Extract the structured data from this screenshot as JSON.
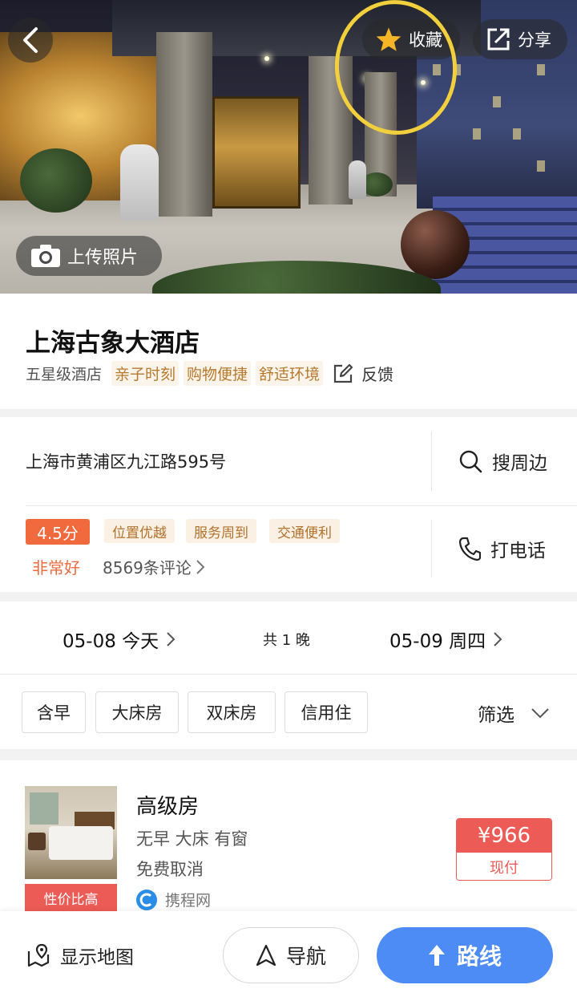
{
  "hero": {
    "favorite_label": "收藏",
    "share_label": "分享",
    "upload_label": "上传照片"
  },
  "hotel": {
    "name": "上海古象大酒店",
    "grade": "五星级酒店",
    "tags": [
      "亲子时刻",
      "购物便捷",
      "舒适环境"
    ],
    "feedback_label": "反馈",
    "address": "上海市黄浦区九江路595号",
    "search_nearby_label": "搜周边",
    "call_label": "打电话",
    "score": "4.5分",
    "score_word": "非常好",
    "score_tags": [
      "位置优越",
      "服务周到",
      "交通便利"
    ],
    "reviews": "8569条评论"
  },
  "dates": {
    "checkin": "05-08 今天",
    "nights": "共 1 晚",
    "checkout": "05-09 周四"
  },
  "filters": {
    "chips": [
      "含早",
      "大床房",
      "双床房",
      "信用住"
    ],
    "screen_label": "筛选"
  },
  "room": {
    "name": "高级房",
    "features": "无早 大床 有窗",
    "cancel": "免费取消",
    "badge": "性价比高",
    "provider": "携程网",
    "price": "¥966",
    "pay_type": "现付"
  },
  "bottom": {
    "map_label": "显示地图",
    "nav_label": "导航",
    "route_label": "路线"
  },
  "colors": {
    "accent": "#4d8cf5",
    "price_red": "#ec5b55",
    "score_orange": "#f06a3d",
    "tag_gold": "#b77a2d",
    "annotation_yellow": "#f2cf3c"
  }
}
